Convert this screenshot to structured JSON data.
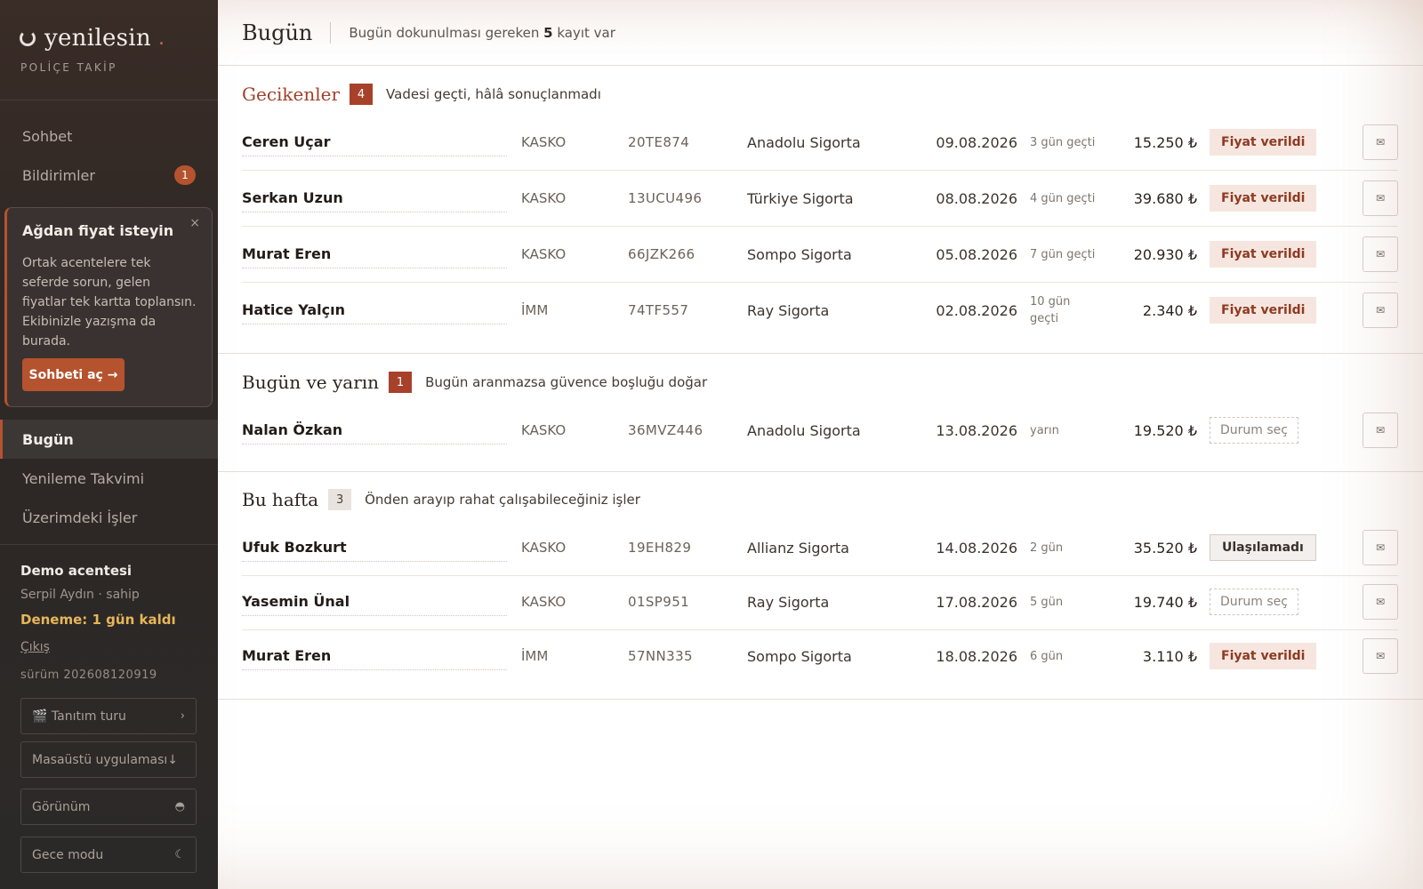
{
  "brand": {
    "name": "yenilesin",
    "dot": ".",
    "subtitle": "POLİÇE TAKİP"
  },
  "nav_top": [
    {
      "label": "Sohbet"
    },
    {
      "label": "Bildirimler",
      "badge": "1"
    }
  ],
  "promo": {
    "title": "Ağdan fiyat isteyin",
    "close": "×",
    "body": "Ortak acentelere tek seferde sorun, gelen fiyatlar tek kartta toplansın. Ekibinizle yazışma da burada.",
    "button": "Sohbeti aç →"
  },
  "nav_main": [
    {
      "label": "Bugün",
      "active": true
    },
    {
      "label": "Yenileme Takvimi"
    },
    {
      "label": "Üzerimdeki İşler"
    }
  ],
  "account": {
    "agency": "Demo acentesi",
    "user": "Serpil Aydın · sahip",
    "trial": "Deneme: 1 gün kaldı",
    "logout": "Çıkış",
    "version": "sürüm 202608120919"
  },
  "side_buttons": [
    {
      "label": "🎬 Tanıtım turu",
      "right": "›",
      "icon": "clapper-icon"
    },
    {
      "label": "Masaüstü uygulaması↓",
      "right": "",
      "icon": "download-icon"
    },
    {
      "label": "Görünüm",
      "right": "◓",
      "icon": "half-circle-icon"
    },
    {
      "label": "Gece modu",
      "right": "☾",
      "icon": "moon-icon"
    }
  ],
  "header": {
    "title": "Bugün",
    "subtitle_pre": "Bugün dokunulması gereken ",
    "subtitle_count": "5",
    "subtitle_post": " kayıt var"
  },
  "sections": [
    {
      "title": "Gecikenler",
      "count": "4",
      "desc": "Vadesi geçti, hâlâ sonuçlanmadı",
      "rows": [
        {
          "name": "Ceren Uçar",
          "type": "KASKO",
          "plate": "20TE874",
          "company": "Anadolu Sigorta",
          "date": "09.08.2026",
          "rel": "3 gün geçti",
          "price": "15.250 ₺",
          "status": "Fiyat verildi",
          "status_kind": "fv"
        },
        {
          "name": "Serkan Uzun",
          "type": "KASKO",
          "plate": "13UCU496",
          "company": "Türkiye Sigorta",
          "date": "08.08.2026",
          "rel": "4 gün geçti",
          "price": "39.680 ₺",
          "status": "Fiyat verildi",
          "status_kind": "fv"
        },
        {
          "name": "Murat Eren",
          "type": "KASKO",
          "plate": "66JZK266",
          "company": "Sompo Sigorta",
          "date": "05.08.2026",
          "rel": "7 gün geçti",
          "price": "20.930 ₺",
          "status": "Fiyat verildi",
          "status_kind": "fv"
        },
        {
          "name": "Hatice Yalçın",
          "type": "İMM",
          "plate": "74TF557",
          "company": "Ray Sigorta",
          "date": "02.08.2026",
          "rel": "10 gün geçti",
          "price": "2.340 ₺",
          "status": "Fiyat verildi",
          "status_kind": "fv"
        }
      ]
    },
    {
      "title": "Bugün ve yarın",
      "count": "1",
      "desc": "Bugün aranmazsa güvence boşluğu doğar",
      "rows": [
        {
          "name": "Nalan Özkan",
          "type": "KASKO",
          "plate": "36MVZ446",
          "company": "Anadolu Sigorta",
          "date": "13.08.2026",
          "rel": "yarın",
          "price": "19.520 ₺",
          "status": "Durum seç",
          "status_kind": "ds"
        }
      ]
    },
    {
      "title": "Bu hafta",
      "count": "3",
      "desc": "Önden arayıp rahat çalışabileceğiniz işler",
      "rows": [
        {
          "name": "Ufuk Bozkurt",
          "type": "KASKO",
          "plate": "19EH829",
          "company": "Allianz Sigorta",
          "date": "14.08.2026",
          "rel": "2 gün",
          "price": "35.520 ₺",
          "status": "Ulaşılamadı",
          "status_kind": "ul"
        },
        {
          "name": "Yasemin Ünal",
          "type": "KASKO",
          "plate": "01SP951",
          "company": "Ray Sigorta",
          "date": "17.08.2026",
          "rel": "5 gün",
          "price": "19.740 ₺",
          "status": "Durum seç",
          "status_kind": "ds"
        },
        {
          "name": "Murat Eren",
          "type": "İMM",
          "plate": "57NN335",
          "company": "Sompo Sigorta",
          "date": "18.08.2026",
          "rel": "6 gün",
          "price": "3.110 ₺",
          "status": "Fiyat verildi",
          "status_kind": "fv"
        }
      ]
    }
  ],
  "row_action": {
    "icon": "mail-icon",
    "glyph": "✉"
  },
  "colors": {
    "accent": "#b5532f",
    "sidebar_bg": "#2b2928",
    "trial": "#e7b65a"
  }
}
